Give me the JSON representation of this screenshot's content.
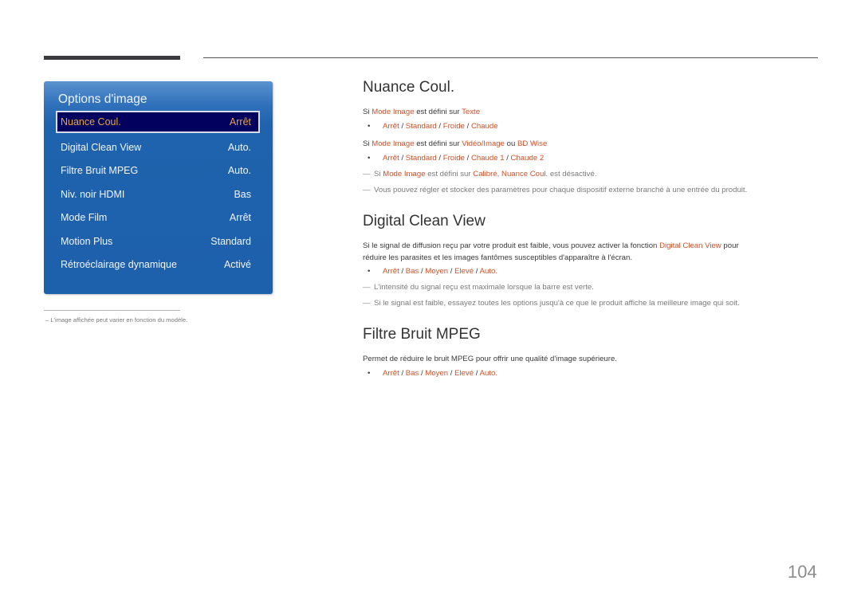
{
  "osd": {
    "title": "Options d'image",
    "items": [
      {
        "label": "Nuance Coul.",
        "value": "Arrêt",
        "selected": true
      },
      {
        "label": "Digital Clean View",
        "value": "Auto."
      },
      {
        "label": "Filtre Bruit MPEG",
        "value": "Auto."
      },
      {
        "label": "Niv. noir HDMI",
        "value": "Bas"
      },
      {
        "label": "Mode Film",
        "value": "Arrêt"
      },
      {
        "label": "Motion Plus",
        "value": "Standard"
      },
      {
        "label": "Rétroéclairage dynamique",
        "value": "Activé"
      }
    ]
  },
  "footnote": "–  L'image affichée peut varier en fonction du modèle.",
  "sections": {
    "nuance": {
      "title": "Nuance Coul.",
      "cond1": {
        "pre": "Si ",
        "hl1": "Mode Image",
        "mid": " est défini sur ",
        "hl2": "Texte"
      },
      "opts1": [
        "Arrêt",
        "Standard",
        "Froide",
        "Chaude"
      ],
      "cond2": {
        "pre": "Si ",
        "hl1": "Mode Image",
        "mid": " est défini sur ",
        "hl2": "Vidéo/Image",
        "mid2": " ou ",
        "hl3": "BD Wise"
      },
      "opts2": [
        "Arrêt",
        "Standard",
        "Froide",
        "Chaude 1",
        "Chaude 2"
      ],
      "note1": {
        "pre": "Si ",
        "hl1": "Mode Image",
        "mid": " est défini sur ",
        "hl2": "Calibré",
        "mid2": ", ",
        "hl3": "Nuance Coul.",
        "post": " est désactivé."
      },
      "note2": "Vous pouvez régler et stocker des paramètres pour chaque dispositif externe branché à une entrée du produit."
    },
    "dcv": {
      "title": "Digital Clean View",
      "desc_pre": "Si le signal de diffusion reçu par votre produit est faible, vous pouvez activer la fonction ",
      "desc_hl": "Digital Clean View",
      "desc_post": " pour",
      "desc_line2": "réduire les parasites et les images fantômes susceptibles d'apparaître à l'écran.",
      "opts": [
        "Arrêt",
        "Bas",
        "Moyen",
        "Elevé",
        "Auto."
      ],
      "note1": "L'intensité du signal reçu est maximale lorsque la barre est verte.",
      "note2": "Si le signal est faible, essayez toutes les options jusqu'à ce que le produit affiche la meilleure image qui soit."
    },
    "mpeg": {
      "title": "Filtre Bruit MPEG",
      "desc": "Permet de réduire le bruit MPEG pour offrir une qualité d'image supérieure.",
      "opts": [
        "Arrêt",
        "Bas",
        "Moyen",
        "Elevé",
        "Auto."
      ]
    }
  },
  "symbols": {
    "bullet": "•",
    "dash": "—",
    "sep": " / "
  },
  "page_number": "104"
}
